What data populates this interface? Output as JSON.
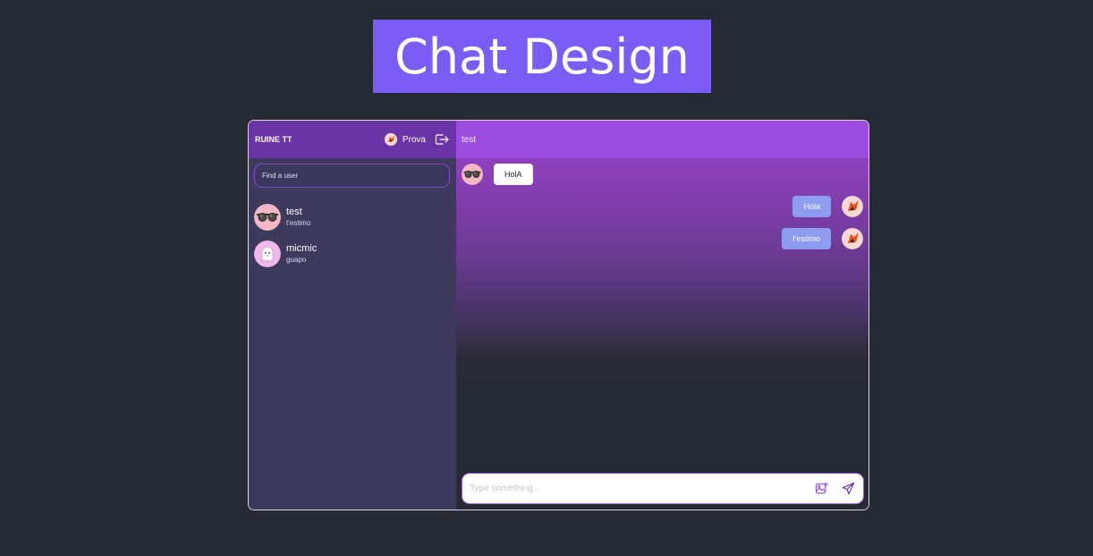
{
  "page": {
    "title": "Chat Design"
  },
  "sidebar": {
    "brand": "RUINE TT",
    "current_user": {
      "name": "Prova",
      "avatar_icon": "fox-avatar-icon"
    },
    "logout_icon": "logout-icon",
    "search": {
      "placeholder": "Find a user",
      "value": ""
    },
    "users": [
      {
        "name": "test",
        "last_message": "t'estimo",
        "avatar_icon": "sunglasses-avatar-icon"
      },
      {
        "name": "micmic",
        "last_message": "guapo",
        "avatar_icon": "ghost-avatar-icon"
      }
    ]
  },
  "chat": {
    "title": "test",
    "messages": [
      {
        "direction": "incoming",
        "text": "HolA",
        "avatar_icon": "sunglasses-avatar-icon"
      },
      {
        "direction": "outgoing",
        "text": "Hola",
        "avatar_icon": "fox-avatar-icon"
      },
      {
        "direction": "outgoing",
        "text": "t'estimo",
        "avatar_icon": "fox-avatar-icon"
      }
    ],
    "composer": {
      "placeholder": "Type something...",
      "value": "",
      "image_icon": "add-image-icon",
      "send_icon": "send-icon"
    }
  },
  "colors": {
    "background": "#262a33",
    "title_bg": "#7b5cf5",
    "sidebar_header": "#6a33a6",
    "sidebar_bg": "#3d3a5e",
    "chat_header": "#9b4de0",
    "outgoing_bubble": "#8e9cf0",
    "incoming_bubble": "#ffffff"
  }
}
